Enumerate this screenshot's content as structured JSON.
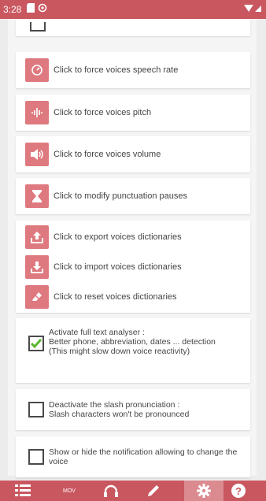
{
  "status_bar": {
    "time": "3:28"
  },
  "actions": {
    "speech_rate": "Click to force voices speech rate",
    "pitch": "Click to force voices pitch",
    "volume": "Click to force voices volume",
    "punctuation": "Click to modify punctuation pauses",
    "export": "Click to export voices dictionaries",
    "import": "Click to import voices dictionaries",
    "reset": "Click to reset voices dictionaries"
  },
  "options": [
    {
      "lines": [
        "Activate full text analyser :",
        "Better phone, abbreviation, dates ... detection",
        "(This might slow down voice reactivity)"
      ],
      "checked": true
    },
    {
      "lines": [
        "Deactivate the slash pronunciation :",
        "Slash characters won't be pronounced"
      ],
      "checked": false
    },
    {
      "lines": [
        "Show or hide the notification allowing to change the",
        "voice"
      ],
      "checked": false
    }
  ],
  "bottom_nav": {
    "mov_label": "MOV",
    "active": "settings"
  },
  "colors": {
    "accent": "#c9575f",
    "icon_bg": "#de7a7f",
    "check_green": "#5bb52f"
  }
}
